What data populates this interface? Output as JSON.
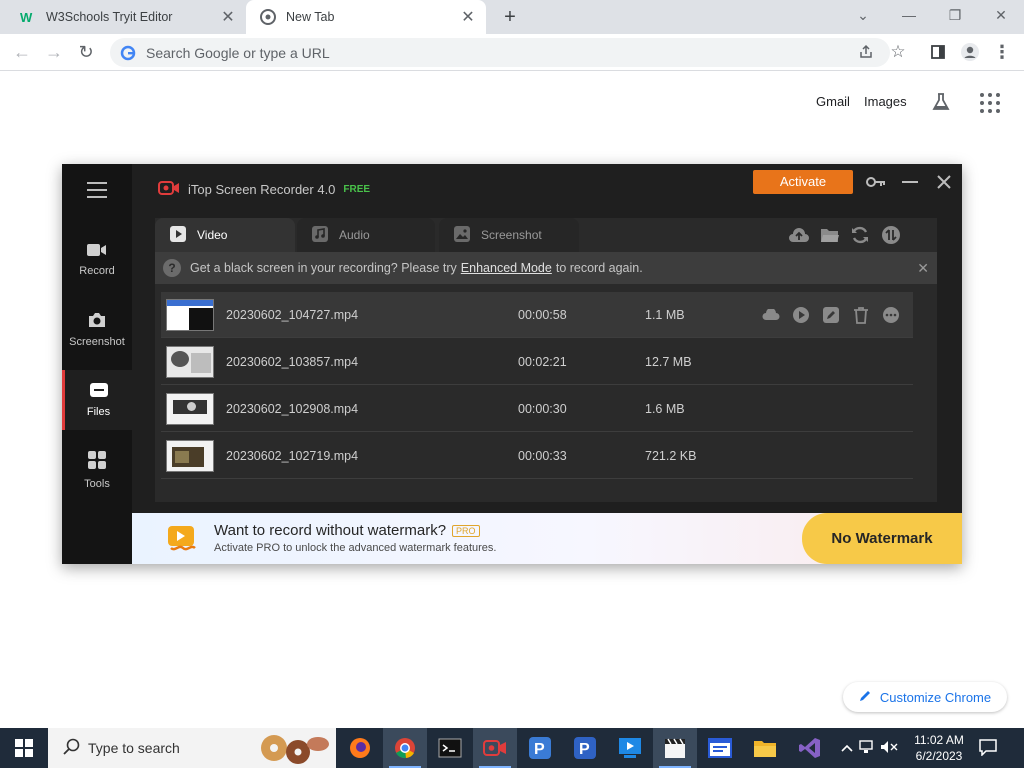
{
  "browser": {
    "tabs": [
      {
        "title": "W3Schools Tryit Editor",
        "active": false
      },
      {
        "title": "New Tab",
        "active": true
      }
    ],
    "omnibox_placeholder": "Search Google or type a URL",
    "ntp_links": {
      "gmail": "Gmail",
      "images": "Images"
    },
    "customize_label": "Customize Chrome"
  },
  "app": {
    "title": "iTop Screen Recorder 4.0",
    "edition": "FREE",
    "activate_label": "Activate",
    "sidebar": [
      {
        "label": "Record",
        "active": false
      },
      {
        "label": "Screenshot",
        "active": false
      },
      {
        "label": "Files",
        "active": true
      },
      {
        "label": "Tools",
        "active": false
      }
    ],
    "tabs": [
      {
        "label": "Video",
        "active": true
      },
      {
        "label": "Audio",
        "active": false
      },
      {
        "label": "Screenshot",
        "active": false
      }
    ],
    "notice": {
      "before": "Get a black screen in your recording? Please try",
      "link": "Enhanced Mode",
      "after": "to record again."
    },
    "files": [
      {
        "name": "20230602_104727.mp4",
        "duration": "00:00:58",
        "size": "1.1 MB"
      },
      {
        "name": "20230602_103857.mp4",
        "duration": "00:02:21",
        "size": "12.7 MB"
      },
      {
        "name": "20230602_102908.mp4",
        "duration": "00:00:30",
        "size": "1.6 MB"
      },
      {
        "name": "20230602_102719.mp4",
        "duration": "00:00:33",
        "size": "721.2 KB"
      }
    ],
    "promo": {
      "headline": "Want to record without watermark?",
      "badge": "PRO",
      "subtext": "Activate PRO to unlock the advanced watermark features.",
      "button": "No Watermark"
    }
  },
  "taskbar": {
    "search_placeholder": "Type to search",
    "time": "11:02 AM",
    "date": "6/2/2023"
  },
  "colors": {
    "accent_orange": "#e8741a",
    "free_green": "#49c24a",
    "promo_yellow": "#f7c948",
    "active_side_marker": "#e03c3c"
  }
}
